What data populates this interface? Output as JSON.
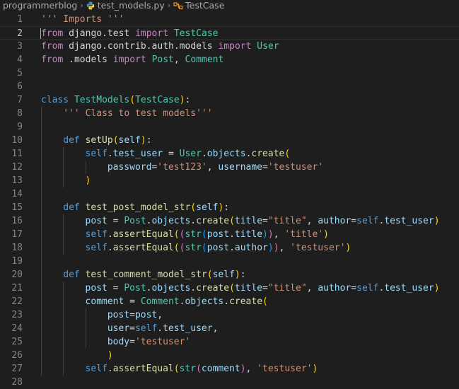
{
  "breadcrumb": {
    "project": "programmerblog",
    "file": "test_models.py",
    "symbol": "TestCase"
  },
  "editor": {
    "current_line": 2,
    "lines": [
      {
        "n": "1",
        "indent": 0,
        "tokens": [
          [
            "str",
            "''' Imports '''"
          ]
        ]
      },
      {
        "n": "2",
        "indent": 0,
        "tokens": [
          [
            "ctl",
            "from"
          ],
          [
            "pl",
            " django.test "
          ],
          [
            "ctl",
            "import"
          ],
          [
            "pl",
            " "
          ],
          [
            "cls",
            "TestCase"
          ]
        ]
      },
      {
        "n": "3",
        "indent": 0,
        "tokens": [
          [
            "ctl",
            "from"
          ],
          [
            "pl",
            " django.contrib.auth.models "
          ],
          [
            "ctl",
            "import"
          ],
          [
            "pl",
            " "
          ],
          [
            "cls",
            "User"
          ]
        ]
      },
      {
        "n": "4",
        "indent": 0,
        "tokens": [
          [
            "ctl",
            "from"
          ],
          [
            "pl",
            " .models "
          ],
          [
            "ctl",
            "import"
          ],
          [
            "pl",
            " "
          ],
          [
            "cls",
            "Post"
          ],
          [
            "pl",
            ", "
          ],
          [
            "cls",
            "Comment"
          ]
        ]
      },
      {
        "n": "5",
        "indent": 0,
        "tokens": []
      },
      {
        "n": "6",
        "indent": 0,
        "tokens": []
      },
      {
        "n": "7",
        "indent": 0,
        "tokens": [
          [
            "kw",
            "class"
          ],
          [
            "pl",
            " "
          ],
          [
            "cls",
            "TestModels"
          ],
          [
            "b1",
            "("
          ],
          [
            "cls",
            "TestCase"
          ],
          [
            "b1",
            ")"
          ],
          [
            "pl",
            ":"
          ]
        ]
      },
      {
        "n": "8",
        "indent": 4,
        "tokens": [
          [
            "str",
            "''' Class to test models'''"
          ]
        ]
      },
      {
        "n": "9",
        "indent": 0,
        "tokens": []
      },
      {
        "n": "10",
        "indent": 4,
        "tokens": [
          [
            "kw",
            "def"
          ],
          [
            "pl",
            " "
          ],
          [
            "fn",
            "setUp"
          ],
          [
            "b1",
            "("
          ],
          [
            "par",
            "self"
          ],
          [
            "b1",
            ")"
          ],
          [
            "pl",
            ":"
          ]
        ]
      },
      {
        "n": "11",
        "indent": 8,
        "tokens": [
          [
            "kw",
            "self"
          ],
          [
            "pl",
            "."
          ],
          [
            "par",
            "test_user"
          ],
          [
            "pl",
            " = "
          ],
          [
            "cls",
            "User"
          ],
          [
            "pl",
            "."
          ],
          [
            "par",
            "objects"
          ],
          [
            "pl",
            "."
          ],
          [
            "fn",
            "create"
          ],
          [
            "b1",
            "("
          ]
        ]
      },
      {
        "n": "12",
        "indent": 12,
        "tokens": [
          [
            "par",
            "password"
          ],
          [
            "pl",
            "="
          ],
          [
            "str",
            "'test123'"
          ],
          [
            "pl",
            ", "
          ],
          [
            "par",
            "username"
          ],
          [
            "pl",
            "="
          ],
          [
            "str",
            "'testuser'"
          ]
        ]
      },
      {
        "n": "13",
        "indent": 8,
        "tokens": [
          [
            "b1",
            ")"
          ]
        ]
      },
      {
        "n": "14",
        "indent": 0,
        "tokens": []
      },
      {
        "n": "15",
        "indent": 4,
        "tokens": [
          [
            "kw",
            "def"
          ],
          [
            "pl",
            " "
          ],
          [
            "fn",
            "test_post_model_str"
          ],
          [
            "b1",
            "("
          ],
          [
            "par",
            "self"
          ],
          [
            "b1",
            ")"
          ],
          [
            "pl",
            ":"
          ]
        ]
      },
      {
        "n": "16",
        "indent": 8,
        "tokens": [
          [
            "par",
            "post"
          ],
          [
            "pl",
            " = "
          ],
          [
            "cls",
            "Post"
          ],
          [
            "pl",
            "."
          ],
          [
            "par",
            "objects"
          ],
          [
            "pl",
            "."
          ],
          [
            "fn",
            "create"
          ],
          [
            "b1",
            "("
          ],
          [
            "par",
            "title"
          ],
          [
            "pl",
            "="
          ],
          [
            "str",
            "\"title\""
          ],
          [
            "pl",
            ", "
          ],
          [
            "par",
            "author"
          ],
          [
            "pl",
            "="
          ],
          [
            "kw",
            "self"
          ],
          [
            "pl",
            "."
          ],
          [
            "par",
            "test_user"
          ],
          [
            "b1",
            ")"
          ]
        ]
      },
      {
        "n": "17",
        "indent": 8,
        "tokens": [
          [
            "kw",
            "self"
          ],
          [
            "pl",
            "."
          ],
          [
            "fn",
            "assertEqual"
          ],
          [
            "b1",
            "("
          ],
          [
            "b2",
            "("
          ],
          [
            "cls",
            "str"
          ],
          [
            "b3",
            "("
          ],
          [
            "par",
            "post"
          ],
          [
            "pl",
            "."
          ],
          [
            "par",
            "title"
          ],
          [
            "b3",
            ")"
          ],
          [
            "b2",
            ")"
          ],
          [
            "pl",
            ", "
          ],
          [
            "str",
            "'title'"
          ],
          [
            "b1",
            ")"
          ]
        ]
      },
      {
        "n": "18",
        "indent": 8,
        "tokens": [
          [
            "kw",
            "self"
          ],
          [
            "pl",
            "."
          ],
          [
            "fn",
            "assertEqual"
          ],
          [
            "b1",
            "("
          ],
          [
            "b2",
            "("
          ],
          [
            "cls",
            "str"
          ],
          [
            "b3",
            "("
          ],
          [
            "par",
            "post"
          ],
          [
            "pl",
            "."
          ],
          [
            "par",
            "author"
          ],
          [
            "b3",
            ")"
          ],
          [
            "b2",
            ")"
          ],
          [
            "pl",
            ", "
          ],
          [
            "str",
            "'testuser'"
          ],
          [
            "b1",
            ")"
          ]
        ]
      },
      {
        "n": "19",
        "indent": 0,
        "tokens": []
      },
      {
        "n": "20",
        "indent": 4,
        "tokens": [
          [
            "kw",
            "def"
          ],
          [
            "pl",
            " "
          ],
          [
            "fn",
            "test_comment_model_str"
          ],
          [
            "b1",
            "("
          ],
          [
            "par",
            "self"
          ],
          [
            "b1",
            ")"
          ],
          [
            "pl",
            ":"
          ]
        ]
      },
      {
        "n": "21",
        "indent": 8,
        "tokens": [
          [
            "par",
            "post"
          ],
          [
            "pl",
            " = "
          ],
          [
            "cls",
            "Post"
          ],
          [
            "pl",
            "."
          ],
          [
            "par",
            "objects"
          ],
          [
            "pl",
            "."
          ],
          [
            "fn",
            "create"
          ],
          [
            "b1",
            "("
          ],
          [
            "par",
            "title"
          ],
          [
            "pl",
            "="
          ],
          [
            "str",
            "\"title\""
          ],
          [
            "pl",
            ", "
          ],
          [
            "par",
            "author"
          ],
          [
            "pl",
            "="
          ],
          [
            "kw",
            "self"
          ],
          [
            "pl",
            "."
          ],
          [
            "par",
            "test_user"
          ],
          [
            "b1",
            ")"
          ]
        ]
      },
      {
        "n": "22",
        "indent": 8,
        "tokens": [
          [
            "par",
            "comment"
          ],
          [
            "pl",
            " = "
          ],
          [
            "cls",
            "Comment"
          ],
          [
            "pl",
            "."
          ],
          [
            "par",
            "objects"
          ],
          [
            "pl",
            "."
          ],
          [
            "fn",
            "create"
          ],
          [
            "b1",
            "("
          ]
        ]
      },
      {
        "n": "23",
        "indent": 12,
        "tokens": [
          [
            "par",
            "post"
          ],
          [
            "pl",
            "="
          ],
          [
            "par",
            "post"
          ],
          [
            "pl",
            ","
          ]
        ]
      },
      {
        "n": "24",
        "indent": 12,
        "tokens": [
          [
            "par",
            "user"
          ],
          [
            "pl",
            "="
          ],
          [
            "kw",
            "self"
          ],
          [
            "pl",
            "."
          ],
          [
            "par",
            "test_user"
          ],
          [
            "pl",
            ","
          ]
        ]
      },
      {
        "n": "25",
        "indent": 12,
        "tokens": [
          [
            "par",
            "body"
          ],
          [
            "pl",
            "="
          ],
          [
            "str",
            "'testuser'"
          ]
        ]
      },
      {
        "n": "26",
        "indent": 12,
        "tokens": [
          [
            "b1",
            ")"
          ]
        ]
      },
      {
        "n": "27",
        "indent": 8,
        "tokens": [
          [
            "kw",
            "self"
          ],
          [
            "pl",
            "."
          ],
          [
            "fn",
            "assertEqual"
          ],
          [
            "b1",
            "("
          ],
          [
            "cls",
            "str"
          ],
          [
            "b2",
            "("
          ],
          [
            "par",
            "comment"
          ],
          [
            "b2",
            ")"
          ],
          [
            "pl",
            ", "
          ],
          [
            "str",
            "'testuser'"
          ],
          [
            "b1",
            ")"
          ]
        ]
      },
      {
        "n": "28",
        "indent": 0,
        "tokens": []
      }
    ]
  }
}
